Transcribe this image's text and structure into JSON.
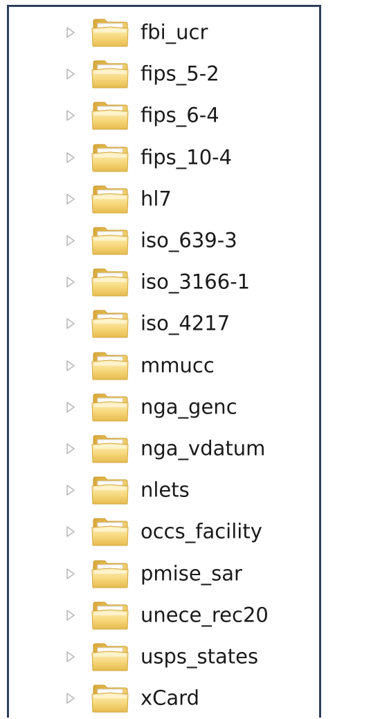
{
  "icons": {
    "expander": "collapsed-triangle-icon",
    "folder": "folder-icon"
  },
  "colors": {
    "frame_border": "#2f3e5c",
    "folder_light": "#fbe7a4",
    "folder_dark": "#e0b64a",
    "expander": "#b9b9b9",
    "text": "#1a1a1a"
  },
  "tree": {
    "items": [
      {
        "label": "fbi_ucr"
      },
      {
        "label": "fips_5-2"
      },
      {
        "label": "fips_6-4"
      },
      {
        "label": "fips_10-4"
      },
      {
        "label": "hl7"
      },
      {
        "label": "iso_639-3"
      },
      {
        "label": "iso_3166-1"
      },
      {
        "label": "iso_4217"
      },
      {
        "label": "mmucc"
      },
      {
        "label": "nga_genc"
      },
      {
        "label": "nga_vdatum"
      },
      {
        "label": "nlets"
      },
      {
        "label": "occs_facility"
      },
      {
        "label": "pmise_sar"
      },
      {
        "label": "unece_rec20"
      },
      {
        "label": "usps_states"
      },
      {
        "label": "xCard"
      }
    ]
  }
}
